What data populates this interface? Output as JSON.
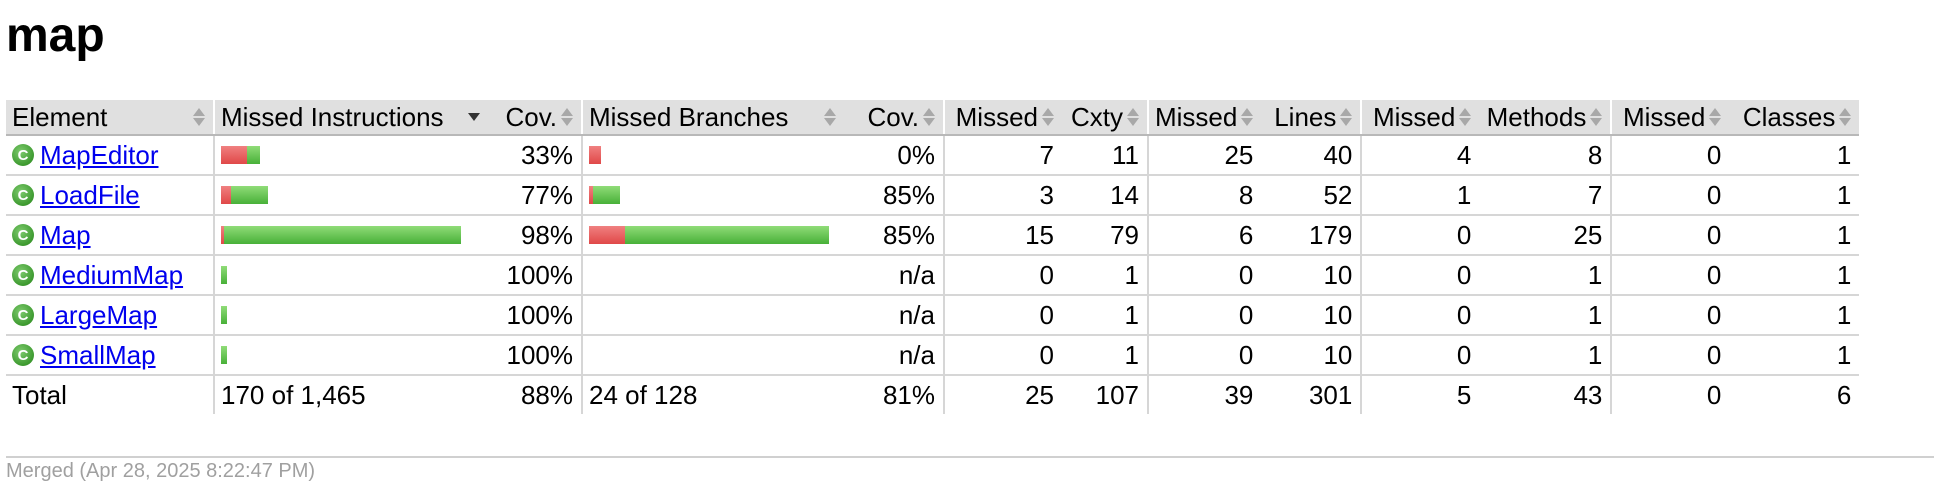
{
  "page_title": "map",
  "headers": {
    "element": "Element",
    "missed_instructions": "Missed Instructions",
    "cov1": "Cov.",
    "missed_branches": "Missed Branches",
    "cov2": "Cov.",
    "missed_cxty": "Missed",
    "cxty": "Cxty",
    "missed_lines": "Missed",
    "lines": "Lines",
    "missed_methods": "Missed",
    "methods": "Methods",
    "missed_classes": "Missed",
    "classes": "Classes"
  },
  "rows": [
    {
      "name": "MapEditor",
      "instr_red": 26,
      "instr_green": 13,
      "instr_cov": "33%",
      "br_red": 12,
      "br_green": 0,
      "br_cov": "0%",
      "missed_cxty": "7",
      "cxty": "11",
      "missed_lines": "25",
      "lines": "40",
      "missed_methods": "4",
      "methods": "8",
      "missed_classes": "0",
      "classes": "1"
    },
    {
      "name": "LoadFile",
      "instr_red": 10,
      "instr_green": 37,
      "instr_cov": "77%",
      "br_red": 4,
      "br_green": 27,
      "br_cov": "85%",
      "missed_cxty": "3",
      "cxty": "14",
      "missed_lines": "8",
      "lines": "52",
      "missed_methods": "1",
      "methods": "7",
      "missed_classes": "0",
      "classes": "1"
    },
    {
      "name": "Map",
      "instr_red": 3,
      "instr_green": 237,
      "instr_cov": "98%",
      "br_red": 36,
      "br_green": 204,
      "br_cov": "85%",
      "missed_cxty": "15",
      "cxty": "79",
      "missed_lines": "6",
      "lines": "179",
      "missed_methods": "0",
      "methods": "25",
      "missed_classes": "0",
      "classes": "1"
    },
    {
      "name": "MediumMap",
      "instr_red": 0,
      "instr_green": 6,
      "instr_cov": "100%",
      "br_red": 0,
      "br_green": 0,
      "br_cov": "n/a",
      "missed_cxty": "0",
      "cxty": "1",
      "missed_lines": "0",
      "lines": "10",
      "missed_methods": "0",
      "methods": "1",
      "missed_classes": "0",
      "classes": "1"
    },
    {
      "name": "LargeMap",
      "instr_red": 0,
      "instr_green": 6,
      "instr_cov": "100%",
      "br_red": 0,
      "br_green": 0,
      "br_cov": "n/a",
      "missed_cxty": "0",
      "cxty": "1",
      "missed_lines": "0",
      "lines": "10",
      "missed_methods": "0",
      "methods": "1",
      "missed_classes": "0",
      "classes": "1"
    },
    {
      "name": "SmallMap",
      "instr_red": 0,
      "instr_green": 6,
      "instr_cov": "100%",
      "br_red": 0,
      "br_green": 0,
      "br_cov": "n/a",
      "missed_cxty": "0",
      "cxty": "1",
      "missed_lines": "0",
      "lines": "10",
      "missed_methods": "0",
      "methods": "1",
      "missed_classes": "0",
      "classes": "1"
    }
  ],
  "total": {
    "label": "Total",
    "instructions": "170 of 1,465",
    "instr_cov": "88%",
    "branches": "24 of 128",
    "br_cov": "81%",
    "missed_cxty": "25",
    "cxty": "107",
    "missed_lines": "39",
    "lines": "301",
    "missed_methods": "5",
    "methods": "43",
    "missed_classes": "0",
    "classes": "6"
  },
  "footer": "Merged (Apr 28, 2025 8:22:47 PM)",
  "icons": {
    "class_icon_glyph": "C"
  },
  "colors": {
    "missed": "#e04848",
    "covered": "#48b038",
    "link": "#0000ee",
    "header_bg": "#e0e0e0"
  }
}
